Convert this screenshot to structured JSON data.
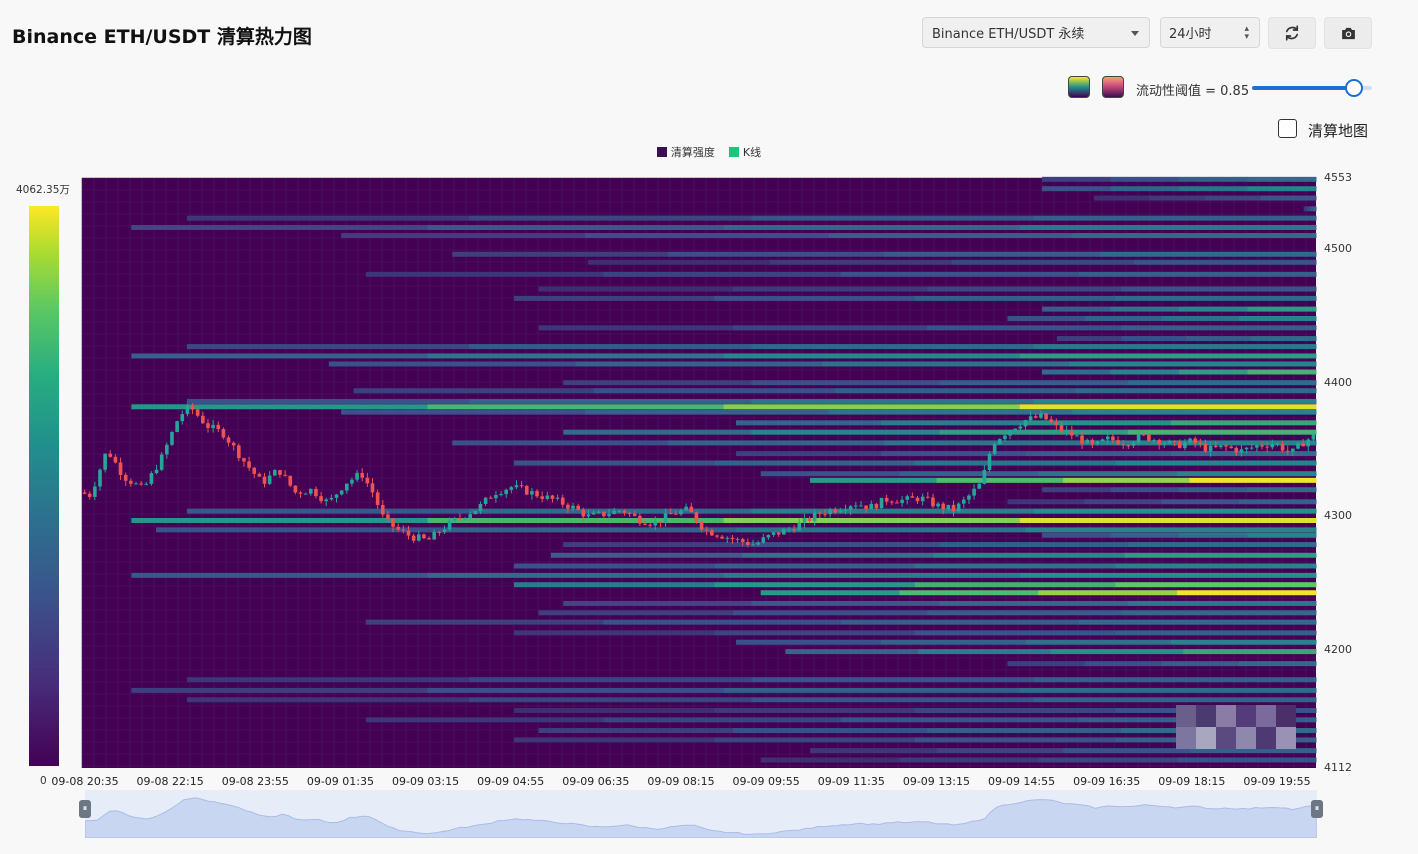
{
  "header": {
    "title": "Binance ETH/USDT 清算热力图",
    "symbol_select": "Binance ETH/USDT 永续",
    "range_select": "24小时",
    "refresh_icon": "refresh-icon",
    "camera_icon": "camera-icon"
  },
  "controls": {
    "palette_viridis_icon": "palette-viridis-icon",
    "palette_warm_icon": "palette-warm-icon",
    "threshold_label": "流动性阈值 = 0.85",
    "threshold_value": 0.85,
    "liquidation_map_label": "清算地图",
    "liquidation_map_checked": false
  },
  "legend": [
    {
      "label": "清算强度",
      "color": "#3b0f53"
    },
    {
      "label": "K线",
      "color": "#20c37a"
    }
  ],
  "colors": {
    "background": "#440154",
    "up": "#26a69a",
    "down": "#ef5350",
    "scale": [
      "#440154",
      "#3b528b",
      "#21918c",
      "#5ec962",
      "#fde725"
    ]
  },
  "chart_data": {
    "type": "heatmap",
    "colorbar": {
      "max_label": "4062.35万",
      "min_label": "0"
    },
    "y_axis": {
      "min": 4112,
      "max": 4553,
      "tick_labels": [
        "4553",
        "4500",
        "4400",
        "4300",
        "4200",
        "4112"
      ],
      "ticks": [
        4553,
        4500,
        4400,
        4300,
        4200,
        4112
      ]
    },
    "x_axis": {
      "tick_labels": [
        "09-08 20:35",
        "09-08 22:15",
        "09-08 23:55",
        "09-09 01:35",
        "09-09 03:15",
        "09-09 04:55",
        "09-09 06:35",
        "09-09 08:15",
        "09-09 09:55",
        "09-09 11:35",
        "09-09 13:15",
        "09-09 14:55",
        "09-09 16:35",
        "09-09 18:15",
        "09-09 19:55"
      ]
    },
    "price_path": [
      [
        0,
        4318
      ],
      [
        0.4,
        4316
      ],
      [
        1,
        4350
      ],
      [
        1.6,
        4330
      ],
      [
        2.3,
        4320
      ],
      [
        3,
        4345
      ],
      [
        3.6,
        4375
      ],
      [
        4,
        4382
      ],
      [
        4.6,
        4368
      ],
      [
        5.2,
        4362
      ],
      [
        6,
        4340
      ],
      [
        6.6,
        4325
      ],
      [
        7.2,
        4335
      ],
      [
        7.8,
        4318
      ],
      [
        8.4,
        4320
      ],
      [
        9,
        4310
      ],
      [
        9.6,
        4325
      ],
      [
        10.2,
        4332
      ],
      [
        10.6,
        4318
      ],
      [
        11,
        4298
      ],
      [
        11.5,
        4290
      ],
      [
        12,
        4285
      ],
      [
        12.6,
        4282
      ],
      [
        13.2,
        4292
      ],
      [
        13.8,
        4300
      ],
      [
        14.4,
        4306
      ],
      [
        15,
        4318
      ],
      [
        15.6,
        4322
      ],
      [
        16,
        4320
      ],
      [
        16.6,
        4316
      ],
      [
        17.2,
        4312
      ],
      [
        17.8,
        4307
      ],
      [
        18.4,
        4300
      ],
      [
        19,
        4302
      ],
      [
        19.6,
        4305
      ],
      [
        20.2,
        4298
      ],
      [
        20.8,
        4295
      ],
      [
        21.4,
        4302
      ],
      [
        22,
        4305
      ],
      [
        22.6,
        4290
      ],
      [
        23.2,
        4286
      ],
      [
        23.8,
        4282
      ],
      [
        24.4,
        4279
      ],
      [
        25,
        4286
      ],
      [
        25.6,
        4290
      ],
      [
        26.2,
        4296
      ],
      [
        26.8,
        4303
      ],
      [
        27.4,
        4306
      ],
      [
        28,
        4310
      ],
      [
        28.6,
        4307
      ],
      [
        29.2,
        4313
      ],
      [
        29.8,
        4312
      ],
      [
        30.4,
        4314
      ],
      [
        31,
        4308
      ],
      [
        31.6,
        4305
      ],
      [
        32,
        4312
      ],
      [
        32.6,
        4325
      ],
      [
        33,
        4355
      ],
      [
        33.6,
        4365
      ],
      [
        34.2,
        4372
      ],
      [
        34.8,
        4375
      ],
      [
        35.4,
        4365
      ],
      [
        36,
        4360
      ],
      [
        36.6,
        4352
      ],
      [
        37.2,
        4358
      ],
      [
        37.8,
        4355
      ],
      [
        38.4,
        4360
      ],
      [
        39,
        4357
      ],
      [
        39.6,
        4353
      ],
      [
        40.2,
        4356
      ],
      [
        40.8,
        4350
      ],
      [
        41.4,
        4352
      ],
      [
        42,
        4349
      ],
      [
        42.6,
        4353
      ],
      [
        43.2,
        4355
      ],
      [
        43.8,
        4347
      ],
      [
        44.2,
        4355
      ],
      [
        44.6,
        4360
      ]
    ],
    "bands": [
      {
        "price": 4552,
        "x_start": 0.778,
        "intensity": 0.35
      },
      {
        "price": 4545,
        "x_start": 0.778,
        "intensity": 0.45
      },
      {
        "price": 4538,
        "x_start": 0.82,
        "intensity": 0.25
      },
      {
        "price": 4530,
        "x_start": 0.99,
        "intensity": 0.3
      },
      {
        "price": 4523,
        "x_start": 0.085,
        "intensity": 0.3
      },
      {
        "price": 4516,
        "x_start": 0.04,
        "intensity": 0.4
      },
      {
        "price": 4510,
        "x_start": 0.21,
        "intensity": 0.35
      },
      {
        "price": 4496,
        "x_start": 0.3,
        "intensity": 0.35
      },
      {
        "price": 4490,
        "x_start": 0.41,
        "intensity": 0.25
      },
      {
        "price": 4481,
        "x_start": 0.23,
        "intensity": 0.3
      },
      {
        "price": 4470,
        "x_start": 0.37,
        "intensity": 0.25
      },
      {
        "price": 4463,
        "x_start": 0.35,
        "intensity": 0.35
      },
      {
        "price": 4455,
        "x_start": 0.778,
        "intensity": 0.55
      },
      {
        "price": 4448,
        "x_start": 0.75,
        "intensity": 0.45
      },
      {
        "price": 4441,
        "x_start": 0.37,
        "intensity": 0.3
      },
      {
        "price": 4433,
        "x_start": 0.79,
        "intensity": 0.35
      },
      {
        "price": 4427,
        "x_start": 0.085,
        "intensity": 0.4
      },
      {
        "price": 4420,
        "x_start": 0.04,
        "intensity": 0.55
      },
      {
        "price": 4414,
        "x_start": 0.2,
        "intensity": 0.45
      },
      {
        "price": 4408,
        "x_start": 0.778,
        "intensity": 0.65
      },
      {
        "price": 4400,
        "x_start": 0.39,
        "intensity": 0.35
      },
      {
        "price": 4394,
        "x_start": 0.22,
        "intensity": 0.35
      },
      {
        "price": 4386,
        "x_start": 0.085,
        "intensity": 0.45
      },
      {
        "price": 4382,
        "x_start": 0.04,
        "intensity": 0.95
      },
      {
        "price": 4378,
        "x_start": 0.21,
        "intensity": 0.45
      },
      {
        "price": 4370,
        "x_start": 0.53,
        "intensity": 0.6
      },
      {
        "price": 4363,
        "x_start": 0.39,
        "intensity": 0.65
      },
      {
        "price": 4355,
        "x_start": 0.3,
        "intensity": 0.45
      },
      {
        "price": 4347,
        "x_start": 0.53,
        "intensity": 0.35
      },
      {
        "price": 4340,
        "x_start": 0.35,
        "intensity": 0.45
      },
      {
        "price": 4332,
        "x_start": 0.55,
        "intensity": 0.45
      },
      {
        "price": 4327,
        "x_start": 0.59,
        "intensity": 0.98
      },
      {
        "price": 4320,
        "x_start": 0.778,
        "intensity": 0.35
      },
      {
        "price": 4311,
        "x_start": 0.75,
        "intensity": 0.3
      },
      {
        "price": 4304,
        "x_start": 0.085,
        "intensity": 0.5
      },
      {
        "price": 4297,
        "x_start": 0.04,
        "intensity": 0.95
      },
      {
        "price": 4290,
        "x_start": 0.06,
        "intensity": 0.45
      },
      {
        "price": 4286,
        "x_start": 0.778,
        "intensity": 0.45
      },
      {
        "price": 4279,
        "x_start": 0.39,
        "intensity": 0.35
      },
      {
        "price": 4271,
        "x_start": 0.38,
        "intensity": 0.55
      },
      {
        "price": 4263,
        "x_start": 0.35,
        "intensity": 0.45
      },
      {
        "price": 4256,
        "x_start": 0.04,
        "intensity": 0.5
      },
      {
        "price": 4249,
        "x_start": 0.35,
        "intensity": 0.75
      },
      {
        "price": 4243,
        "x_start": 0.55,
        "intensity": 0.98
      },
      {
        "price": 4235,
        "x_start": 0.39,
        "intensity": 0.4
      },
      {
        "price": 4228,
        "x_start": 0.37,
        "intensity": 0.35
      },
      {
        "price": 4221,
        "x_start": 0.23,
        "intensity": 0.35
      },
      {
        "price": 4213,
        "x_start": 0.35,
        "intensity": 0.3
      },
      {
        "price": 4206,
        "x_start": 0.53,
        "intensity": 0.45
      },
      {
        "price": 4199,
        "x_start": 0.57,
        "intensity": 0.6
      },
      {
        "price": 4190,
        "x_start": 0.75,
        "intensity": 0.35
      },
      {
        "price": 4178,
        "x_start": 0.085,
        "intensity": 0.3
      },
      {
        "price": 4170,
        "x_start": 0.04,
        "intensity": 0.35
      },
      {
        "price": 4163,
        "x_start": 0.085,
        "intensity": 0.3
      },
      {
        "price": 4155,
        "x_start": 0.35,
        "intensity": 0.25
      },
      {
        "price": 4148,
        "x_start": 0.23,
        "intensity": 0.3
      },
      {
        "price": 4140,
        "x_start": 0.37,
        "intensity": 0.35
      },
      {
        "price": 4133,
        "x_start": 0.35,
        "intensity": 0.3
      },
      {
        "price": 4125,
        "x_start": 0.59,
        "intensity": 0.3
      },
      {
        "price": 4118,
        "x_start": 0.55,
        "intensity": 0.25
      }
    ]
  }
}
